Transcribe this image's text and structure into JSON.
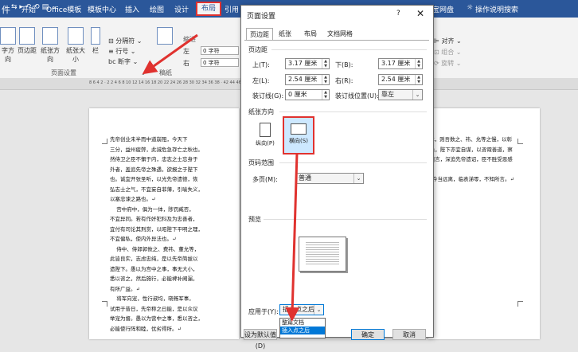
{
  "titlebar": {
    "quick_access": [
      "⇆",
      "▸",
      "↶",
      "⟲",
      "🖫",
      "▤",
      "⌄"
    ],
    "tabs": [
      "开始",
      "Office模板",
      "模板中心",
      "插入",
      "绘图",
      "设计",
      "布局",
      "引用"
    ],
    "right_tabs": [
      "宝网盘",
      "操作说明搜索"
    ],
    "left_partial": "件"
  },
  "ribbon": {
    "buttons": [
      "字方向",
      "页边距",
      "纸张方向",
      "纸张大小",
      "栏"
    ],
    "small_cmds": [
      "分隔符",
      "行号",
      "断字"
    ],
    "indent_label": "缩进",
    "indent_left": "0 字符",
    "indent_right": "0 字符",
    "group_page_setup": "页面设置",
    "group_paragraph": "稿纸",
    "arrange": [
      "对齐",
      "组合",
      "旋转"
    ],
    "left_letters": [
      "左",
      "右"
    ]
  },
  "ruler": {
    "numbers": "8 6 4 2 · 2 2 4 6 8 10 12 14 16 18 20 22 24 26 28 30 32 34 36 38 · 42 44 46 48"
  },
  "document": {
    "left_page": "先帝创业未半而中道崩殂，今天下\n三分，益州疲弊，此诚危急存亡之秋也。\n然侍卫之臣不懈于内，忠志之士忘身于\n外者，盖追先帝之殊遇，欲报之于陛下\n也。诚宜开张圣听，以光先帝遗德，恢\n弘志士之气，不宜妄自菲薄，引喻失义，\n以塞忠谏之路也。↵\n    宫中府中，俱为一体，陟罚臧否，\n不宜异同。若有作奸犯科及为忠善者，\n宜付有司论其刑赏，以昭陛下平明之理，\n不宜偏私，使内外异法也。↵\n    侍中、侍郎郭攸之、费祎、董允等，\n此皆良实，志虑忠纯，是以先帝简拔以\n遗陛下。愚以为宫中之事，事无大小，\n悉以咨之，然后施行，必能裨补阙漏，\n有所广益。↵\n    将军向宠，性行淑均，晓畅军事，\n试用于昔日，先帝称之曰能，是以众议\n举宠为督。愚以为营中之事，悉以咨之，\n必能使行阵和睦，优劣得所。↵",
    "right_page": "t，则吾数之、祎、允等之慢，以彰\n」，陛下亦宜自谋，以咨诹善道，察\n‖言，深追先帝遗诏，臣不胜受恩感\n\n今当远离，临表涕零，不知所言。↵"
  },
  "dialog": {
    "title": "页面设置",
    "help": "?",
    "close": "✕",
    "tabs": [
      "页边距",
      "纸张",
      "布局",
      "文档网格"
    ],
    "margins_section": "页边距",
    "top_label": "上(T):",
    "top_value": "3.17 厘米",
    "bottom_label": "下(B):",
    "bottom_value": "3.17 厘米",
    "left_label": "左(L):",
    "left_value": "2.54 厘米",
    "right_label": "右(R):",
    "right_value": "2.54 厘米",
    "gutter_label": "装订线(G):",
    "gutter_value": "0 厘米",
    "gutter_pos_label": "装订线位置(U):",
    "gutter_pos_value": "靠左",
    "orientation_section": "纸张方向",
    "portrait": "纵向(P)",
    "landscape": "横向(S)",
    "pages_section": "页码范围",
    "multiple_label": "多页(M):",
    "multiple_value": "普通",
    "preview_section": "预览",
    "apply_label": "应用于(Y):",
    "apply_value": "插入点之后",
    "apply_options": [
      "整篇文档",
      "插入点之后"
    ],
    "set_default": "设为默认值(D)",
    "ok": "确定",
    "cancel": "取消"
  },
  "colors": {
    "accent": "#2b579a",
    "highlight": "#e0322f",
    "select": "#0078d7"
  }
}
